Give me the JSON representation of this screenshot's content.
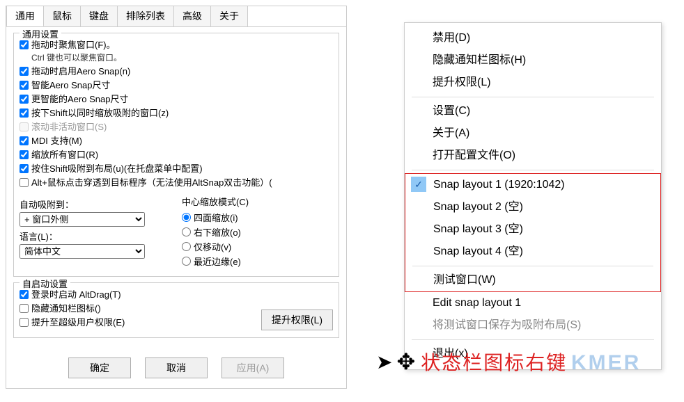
{
  "tabs": [
    "通用",
    "鼠标",
    "键盘",
    "排除列表",
    "高级",
    "关于"
  ],
  "general": {
    "legend": "通用设置",
    "items": [
      {
        "label": "拖动时聚焦窗口(F)。",
        "checked": true,
        "note": "Ctrl 键也可以聚焦窗口。"
      },
      {
        "label": "拖动时启用Aero Snap(n)",
        "checked": true
      },
      {
        "label": "智能Aero Snap尺寸",
        "checked": true
      },
      {
        "label": "更智能的Aero Snap尺寸",
        "checked": true
      },
      {
        "label": "按下Shift以同时缩放吸附的窗口(z)",
        "checked": true
      },
      {
        "label": "滚动非活动窗口(S)",
        "checked": false,
        "disabled": true
      },
      {
        "label": "MDI 支持(M)",
        "checked": true
      },
      {
        "label": "缩放所有窗口(R)",
        "checked": true
      },
      {
        "label": "按住Shift吸附到布局(u)(在托盘菜单中配置)",
        "checked": true
      },
      {
        "label": "Alt+鼠标点击穿透到目标程序（无法使用AltSnap双击功能）(",
        "checked": false
      }
    ],
    "auto_snap_label": "自动吸附到：",
    "auto_snap_value": "+ 窗口外侧",
    "lang_label": "语言(L)：",
    "lang_value": "简体中文",
    "scale_mode_label": "中心缩放模式(C)",
    "scale_modes": [
      {
        "label": "四面缩放(i)",
        "checked": true
      },
      {
        "label": "右下缩放(o)",
        "checked": false
      },
      {
        "label": "仅移动(v)",
        "checked": false
      },
      {
        "label": "最近边缘(e)",
        "checked": false
      }
    ]
  },
  "autostart": {
    "legend": "自启动设置",
    "items": [
      {
        "label": "登录时启动 AltDrag(T)",
        "checked": true
      },
      {
        "label": "隐藏通知栏图标()",
        "checked": false
      },
      {
        "label": "提升至超级用户权限(E)",
        "checked": false
      }
    ],
    "elevate_btn": "提升权限(L)"
  },
  "buttons": {
    "ok": "确定",
    "cancel": "取消",
    "apply": "应用(A)"
  },
  "ctx": {
    "items1": [
      "禁用(D)",
      "隐藏通知栏图标(H)",
      "提升权限(L)"
    ],
    "items2": [
      "设置(C)",
      "关于(A)",
      "打开配置文件(O)"
    ],
    "snap": [
      {
        "label": "Snap layout 1  (1920:1042)",
        "checked": true
      },
      {
        "label": "Snap layout 2  (空)"
      },
      {
        "label": "Snap layout 3  (空)"
      },
      {
        "label": "Snap layout 4  (空)"
      }
    ],
    "test_window": "测试窗口(W)",
    "edit_layout": "Edit snap layout 1",
    "save_test": "将测试窗口保存为吸附布局(S)",
    "exit": "退出(x)"
  },
  "annotation": "状态栏图标右键",
  "watermark": "KMER"
}
